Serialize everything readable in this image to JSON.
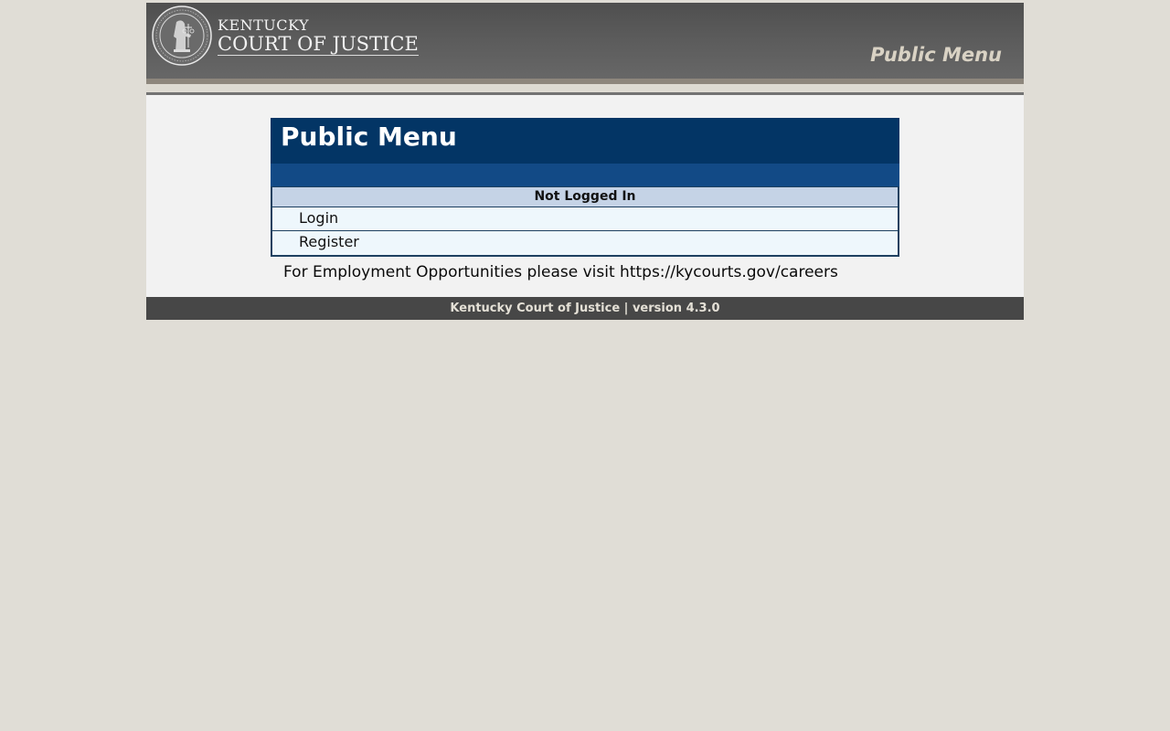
{
  "header": {
    "logo_line1": "KENTUCKY",
    "logo_line2": "COURT OF JUSTICE",
    "banner_title": "Public Menu",
    "seal_icon": "kentucky-seal-icon"
  },
  "menu": {
    "title": "Public Menu",
    "status": "Not Logged In",
    "items": [
      {
        "label": "Login"
      },
      {
        "label": "Register"
      }
    ]
  },
  "notice": {
    "employment": "For Employment Opportunities please visit https://kycourts.gov/careers"
  },
  "footer": {
    "text": "Kentucky Court of Justice | version 4.3.0"
  },
  "colors": {
    "page_bg": "#e0ddd6",
    "menu_title_bg": "#033565",
    "menu_subbar_bg": "#124a86",
    "status_row_bg": "#c5d3e6",
    "menu_item_bg": "#eef7fc",
    "footer_bg": "#474747"
  }
}
